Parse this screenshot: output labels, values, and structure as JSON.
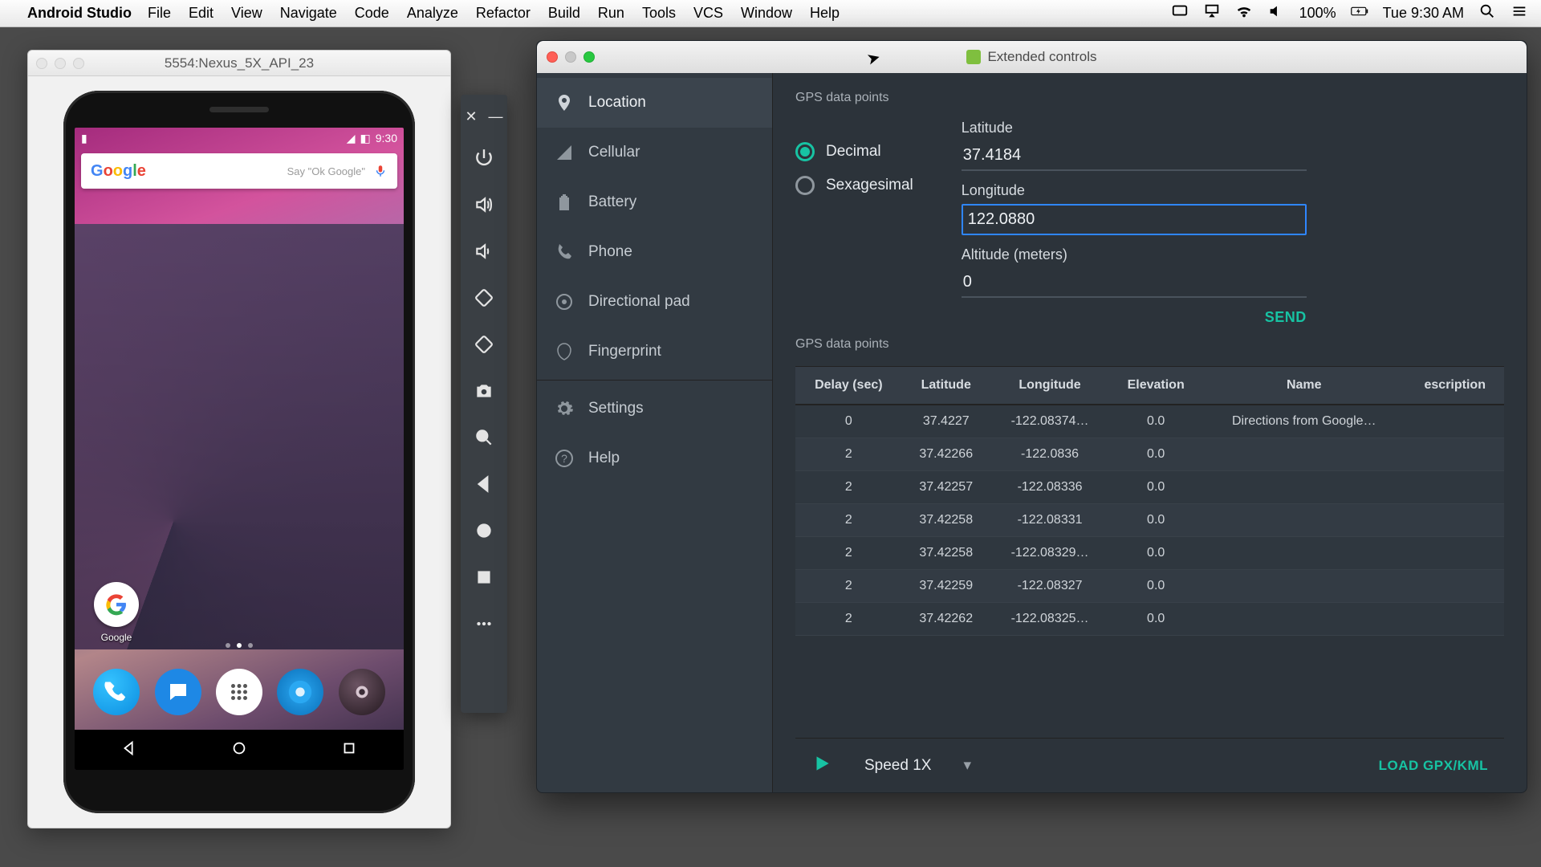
{
  "menubar": {
    "app": "Android Studio",
    "items": [
      "File",
      "Edit",
      "View",
      "Navigate",
      "Code",
      "Analyze",
      "Refactor",
      "Build",
      "Run",
      "Tools",
      "VCS",
      "Window",
      "Help"
    ],
    "battery": "100%",
    "clock": "Tue 9:30 AM"
  },
  "emulator": {
    "title": "5554:Nexus_5X_API_23",
    "status_time": "9:30",
    "search_hint": "Say \"Ok Google\"",
    "google_label": "Google"
  },
  "ext": {
    "title": "Extended controls",
    "nav": [
      "Location",
      "Cellular",
      "Battery",
      "Phone",
      "Directional pad",
      "Fingerprint",
      "Settings",
      "Help"
    ],
    "section1": "GPS data points",
    "radio_decimal": "Decimal",
    "radio_sexagesimal": "Sexagesimal",
    "lat_label": "Latitude",
    "lat_value": "37.4184",
    "lon_label": "Longitude",
    "lon_value": "122.0880",
    "alt_label": "Altitude (meters)",
    "alt_value": "0",
    "send": "SEND",
    "section2": "GPS data points",
    "columns": [
      "Delay (sec)",
      "Latitude",
      "Longitude",
      "Elevation",
      "Name",
      "escription"
    ],
    "rows": [
      {
        "delay": "0",
        "lat": "37.4227",
        "lon": "-122.08374…",
        "elev": "0.0",
        "name": "Directions from Google…",
        "desc": ""
      },
      {
        "delay": "2",
        "lat": "37.42266",
        "lon": "-122.0836",
        "elev": "0.0",
        "name": "",
        "desc": ""
      },
      {
        "delay": "2",
        "lat": "37.42257",
        "lon": "-122.08336",
        "elev": "0.0",
        "name": "",
        "desc": ""
      },
      {
        "delay": "2",
        "lat": "37.42258",
        "lon": "-122.08331",
        "elev": "0.0",
        "name": "",
        "desc": ""
      },
      {
        "delay": "2",
        "lat": "37.42258",
        "lon": "-122.08329…",
        "elev": "0.0",
        "name": "",
        "desc": ""
      },
      {
        "delay": "2",
        "lat": "37.42259",
        "lon": "-122.08327",
        "elev": "0.0",
        "name": "",
        "desc": ""
      },
      {
        "delay": "2",
        "lat": "37.42262",
        "lon": "-122.08325…",
        "elev": "0.0",
        "name": "",
        "desc": ""
      }
    ],
    "speed": "Speed 1X",
    "load": "LOAD GPX/KML"
  }
}
